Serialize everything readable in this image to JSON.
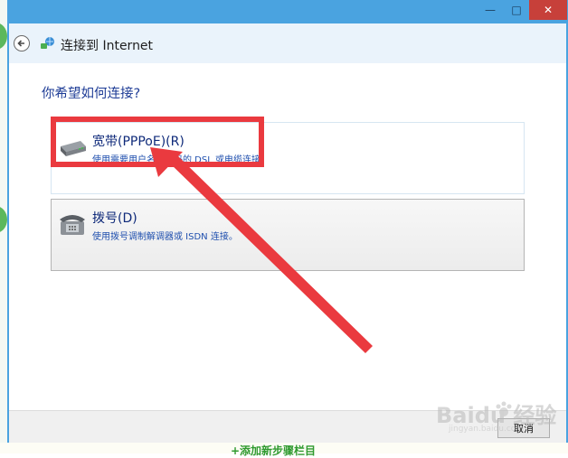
{
  "window": {
    "title": "连接到 Internet",
    "controls": {
      "minimize": "—",
      "maximize": "□",
      "close": "✕"
    }
  },
  "dialog": {
    "question": "你希望如何连接?",
    "options": [
      {
        "title": "宽带(PPPoE)(R)",
        "description": "使用需要用户名和密码的 DSL 或电缆连接。",
        "icon": "broadband-modem-icon"
      },
      {
        "title": "拨号(D)",
        "description": "使用拨号调制解调器或 ISDN 连接。",
        "icon": "dialup-phone-icon"
      }
    ],
    "cancel_label": "取消"
  },
  "background": {
    "bottom_text": "+添加新步骤栏目"
  },
  "watermark": {
    "brand": "Baidu 经验",
    "url": "jingyan.baidu.com"
  },
  "colors": {
    "accent": "#4aa3e0",
    "annotation": "#ea3a3f",
    "link": "#1f4fae"
  }
}
